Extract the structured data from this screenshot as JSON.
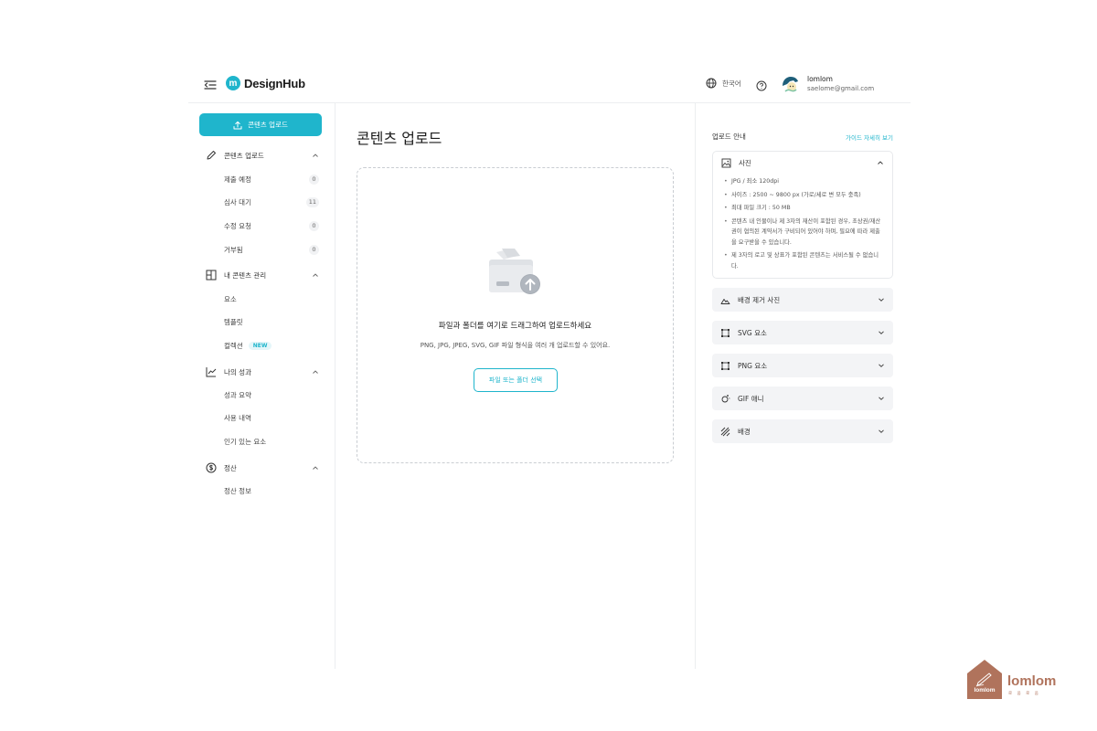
{
  "header": {
    "logo_mark": "m",
    "logo_text": "DesignHub",
    "language": "한국어",
    "user_name": "lomlom",
    "user_email": "saelome@gmail.com"
  },
  "sidebar": {
    "upload_button": "콘텐츠 업로드",
    "sections": [
      {
        "label": "콘텐츠 업로드",
        "icon": "pencil-icon",
        "items": [
          {
            "label": "제출 예정",
            "count": "0"
          },
          {
            "label": "심사 대기",
            "count": "11"
          },
          {
            "label": "수정 요청",
            "count": "0"
          },
          {
            "label": "거부됨",
            "count": "0"
          }
        ]
      },
      {
        "label": "내 콘텐츠 관리",
        "icon": "grid-icon",
        "items": [
          {
            "label": "요소"
          },
          {
            "label": "템플릿"
          },
          {
            "label": "컬렉션",
            "badge": "NEW"
          }
        ]
      },
      {
        "label": "나의 성과",
        "icon": "chart-line-icon",
        "items": [
          {
            "label": "성과 요약"
          },
          {
            "label": "사용 내역"
          },
          {
            "label": "인기 있는 요소"
          }
        ]
      },
      {
        "label": "정산",
        "icon": "dollar-icon",
        "items": [
          {
            "label": "정산 정보"
          }
        ]
      }
    ]
  },
  "main": {
    "title": "콘텐츠 업로드",
    "dropzone": {
      "title": "파일과 폴더를 여기로 드래그하여 업로드하세요",
      "description": "PNG, JPG, JPEG, SVG, GIF 파일 형식을 여러 개 업로드할 수 있어요.",
      "button": "파일 또는 폴더 선택"
    }
  },
  "guide": {
    "title": "업로드 안내",
    "link": "가이드 자세히 보기",
    "open_panel": {
      "label": "사진",
      "rules": [
        "JPG / 최소 120dpi",
        "사이즈 : 2500 ~ 9800 px (가로/세로 변 모두 충족)",
        "최대 파일 크기 : 50 MB",
        "콘텐츠 내 인물이나 제 3자의 재산이 포함된 경우, 초상권/재산권이 협의된 계약서가 구비되어 있어야 하며, 필요에 따라 제출을 요구받을 수 있습니다.",
        "제 3자의 로고 및 상표가 포함된 콘텐츠는 서비스될 수 없습니다."
      ]
    },
    "panels": [
      {
        "label": "배경 제거 사진",
        "icon": "mountain-icon"
      },
      {
        "label": "SVG 요소",
        "icon": "vector-icon"
      },
      {
        "label": "PNG 요소",
        "icon": "vector-icon"
      },
      {
        "label": "GIF 애니",
        "icon": "sparkle-icon"
      },
      {
        "label": "배경",
        "icon": "hatch-icon"
      }
    ]
  },
  "watermark": {
    "house_text": "lomlom",
    "text": "lomlom",
    "sub": "로 움 로 움"
  },
  "colors": {
    "accent": "#1fb5cc",
    "watermark": "#b0735c"
  }
}
